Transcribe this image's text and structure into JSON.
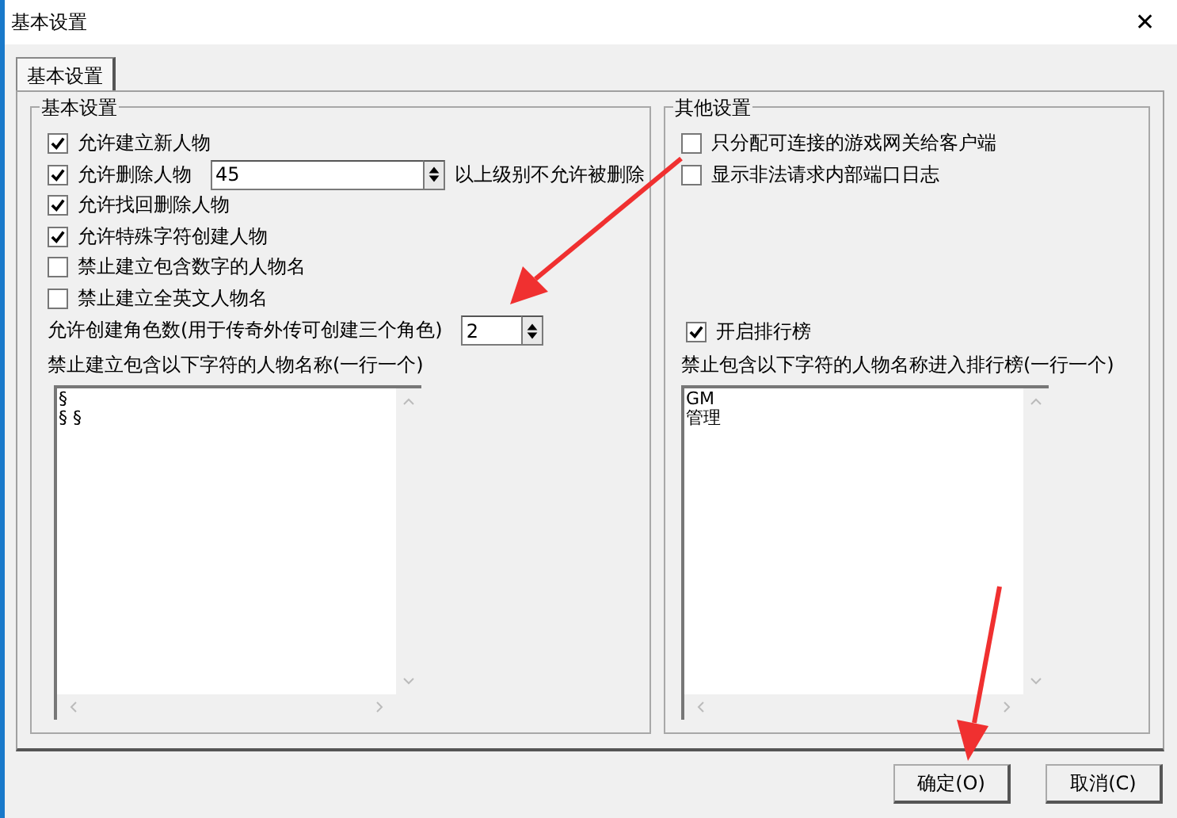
{
  "window": {
    "title": "基本设置",
    "close": "✕"
  },
  "tabs": [
    {
      "label": "基本设置",
      "selected": true
    }
  ],
  "basic": {
    "title": "基本设置",
    "options": [
      {
        "label": "允许建立新人物",
        "checked": true
      },
      {
        "label": "允许删除人物",
        "checked": true,
        "value": "45",
        "suffix": "以上级别不允许被删除"
      },
      {
        "label": "允许找回删除人物",
        "checked": true
      },
      {
        "label": "允许特殊字符创建人物",
        "checked": true
      },
      {
        "label": "禁止建立包含数字的人物名",
        "checked": false
      },
      {
        "label": "禁止建立全英文人物名",
        "checked": false
      }
    ],
    "role_count": {
      "label": "允许创建角色数(用于传奇外传可创建三个角色)",
      "value": "2"
    },
    "list_label": "禁止建立包含以下字符的人物名称(一行一个)",
    "list_lines": [
      "§",
      "§ §"
    ]
  },
  "other": {
    "title": "其他设置",
    "options": [
      {
        "label": "只分配可连接的游戏网关给客户端",
        "checked": false
      },
      {
        "label": "显示非法请求内部端口日志",
        "checked": false
      }
    ],
    "ranking": {
      "label": "开启排行榜",
      "checked": true
    },
    "list_label": "禁止包含以下字符的人物名称进入排行榜(一行一个)",
    "list_lines": [
      "GM",
      "管理"
    ]
  },
  "buttons": [
    {
      "label": "确定(O)"
    },
    {
      "label": "取消(C)"
    }
  ]
}
